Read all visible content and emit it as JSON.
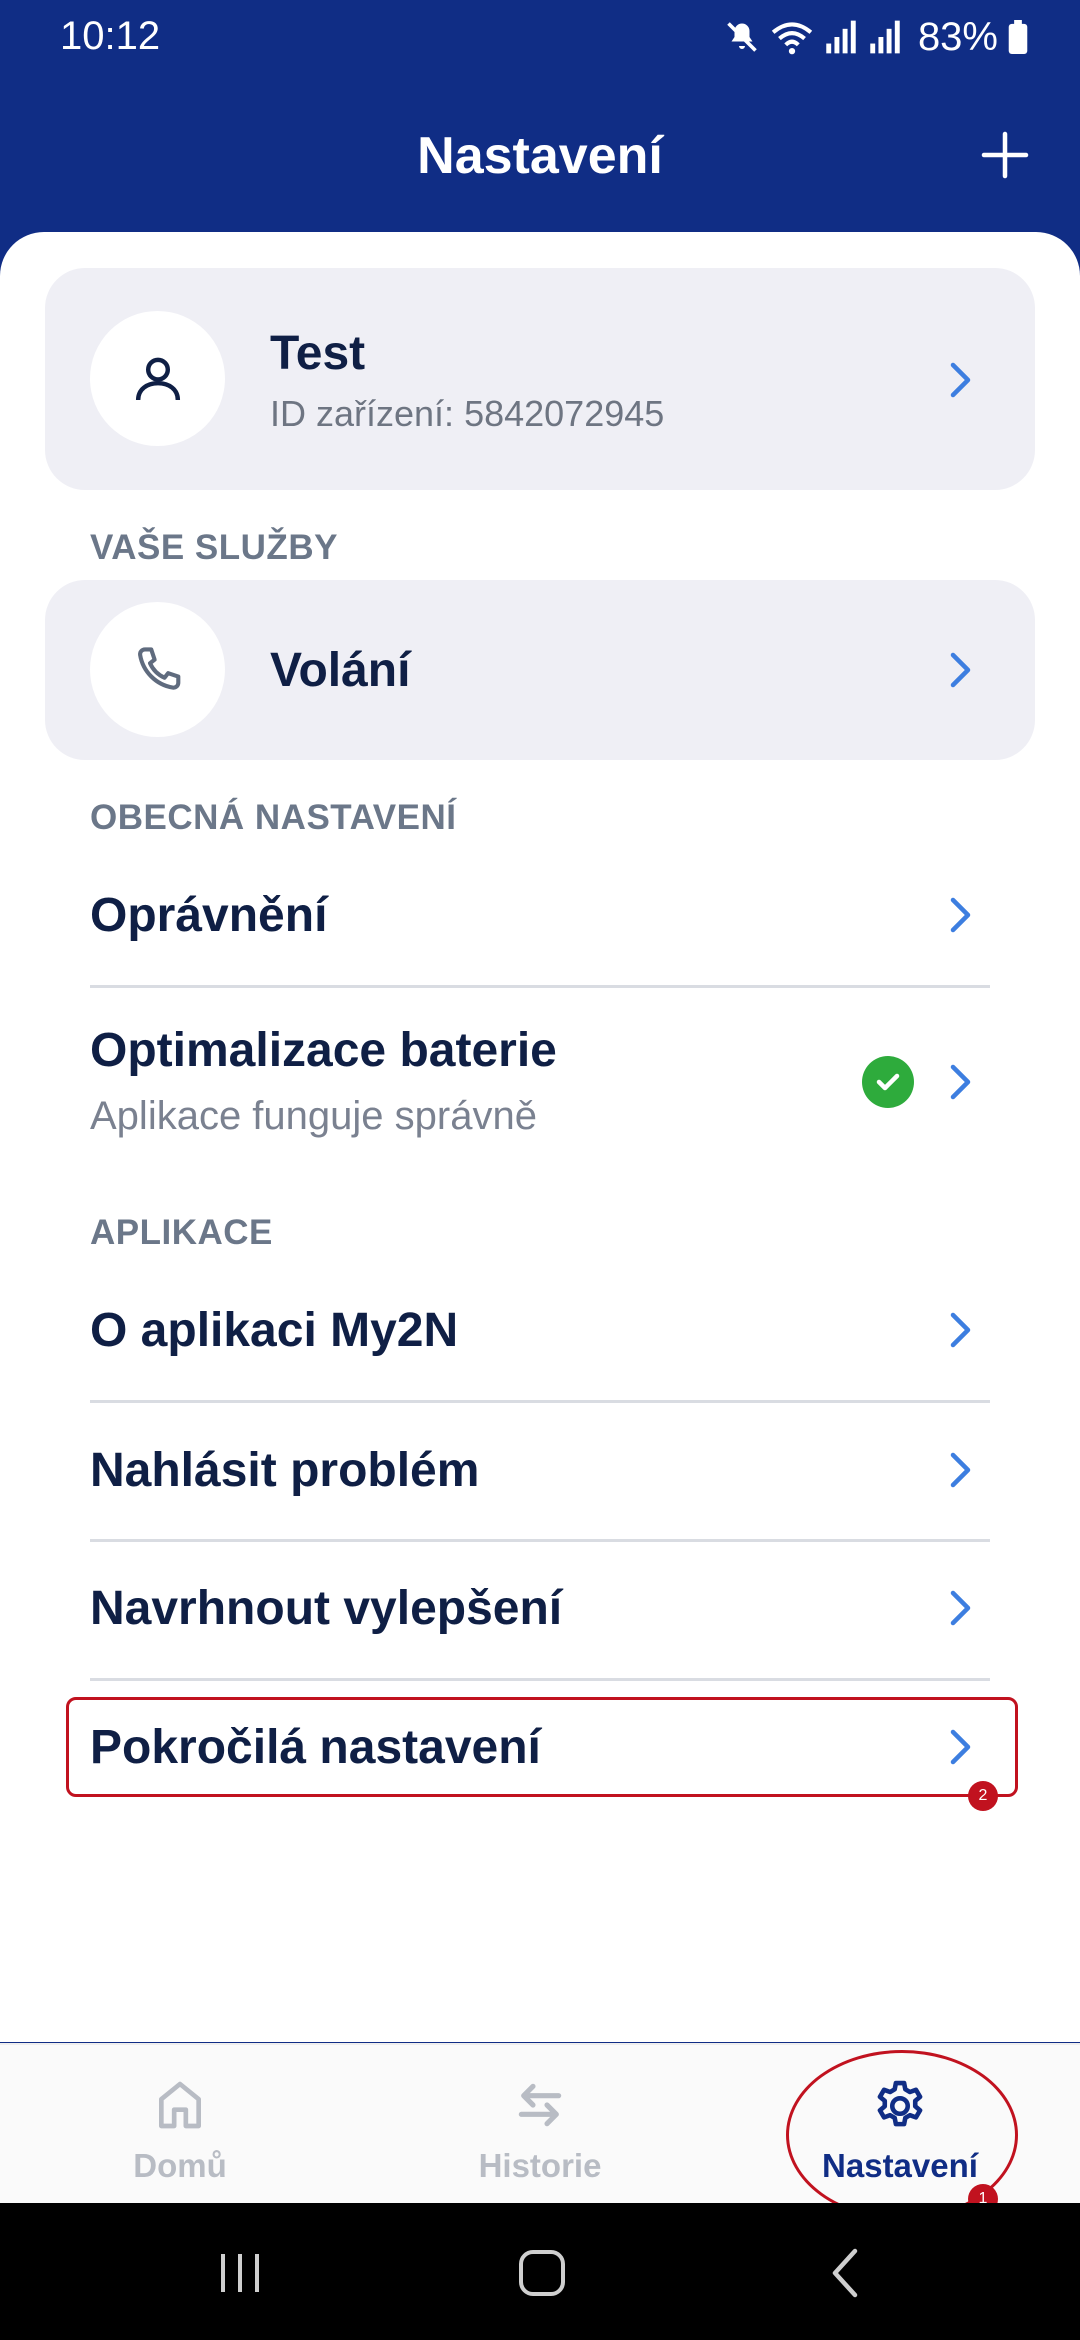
{
  "status_bar": {
    "time": "10:12",
    "battery": "83%"
  },
  "header": {
    "title": "Nastavení"
  },
  "account": {
    "name": "Test",
    "device_id": "ID zařízení: 5842072945"
  },
  "sections": {
    "services": "VAŠE SLUŽBY",
    "general": "OBECNÁ NASTAVENÍ",
    "application": "APLIKACE"
  },
  "services": {
    "calling": "Volání"
  },
  "general": {
    "permissions": "Oprávnění",
    "battery_title": "Optimalizace baterie",
    "battery_status": "Aplikace funguje správně"
  },
  "application": {
    "about": "O aplikaci My2N",
    "report": "Nahlásit problém",
    "suggest": "Navrhnout vylepšení",
    "advanced": "Pokročilá nastavení"
  },
  "markers": {
    "advanced": "2",
    "settings_tab": "1"
  },
  "bottom_nav": {
    "home": "Domů",
    "history": "Historie",
    "settings": "Nastavení",
    "active": "settings"
  },
  "colors": {
    "brand": "#102d85",
    "accent_chevron": "#3d7ee0",
    "success": "#2eab3c",
    "highlight": "#c1121f"
  },
  "icons": {
    "account": "person-icon",
    "calling": "phone-icon",
    "status_ok": "check-circle-icon",
    "add": "plus-icon",
    "home": "home-icon",
    "history": "swap-arrows-icon",
    "settings": "gear-icon"
  }
}
